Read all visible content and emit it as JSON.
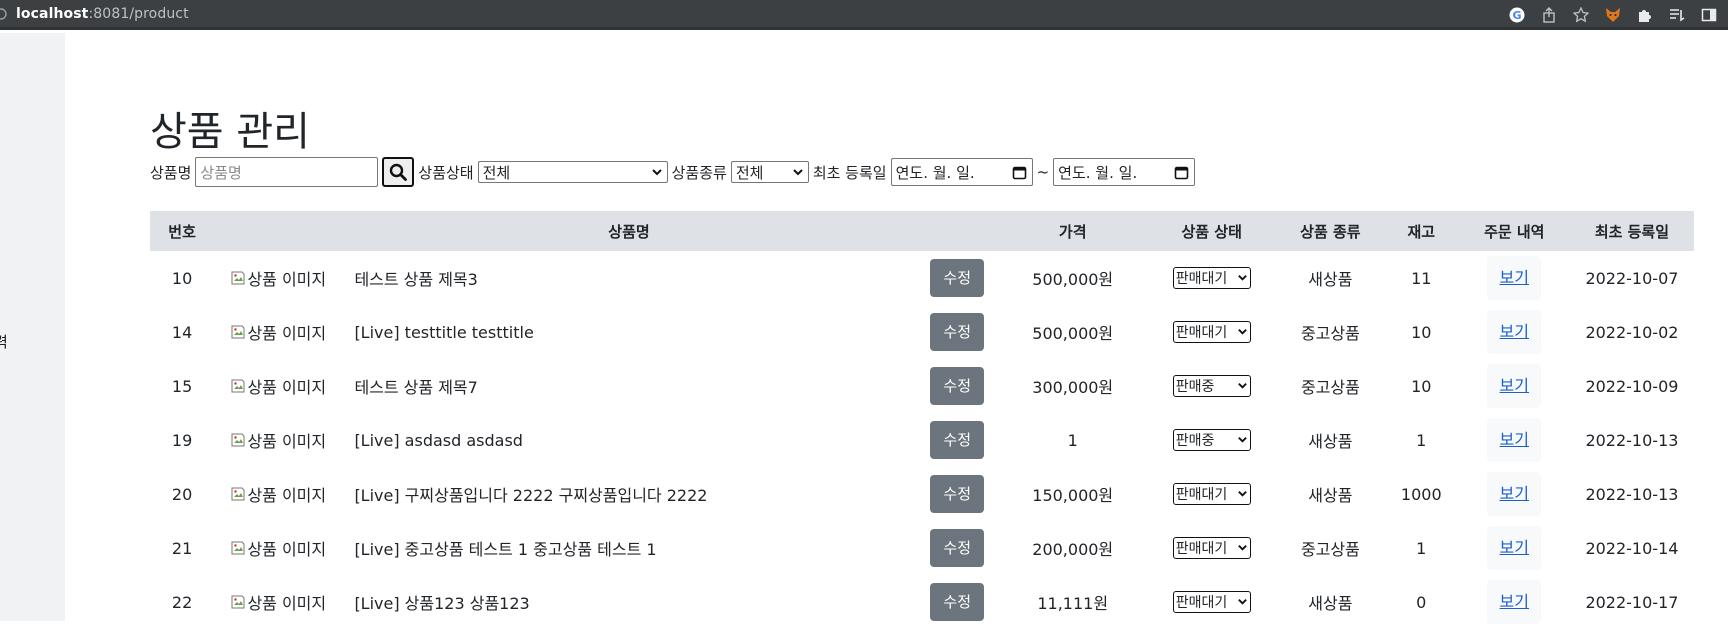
{
  "browser": {
    "url_host": "localhost",
    "url_rest": ":8081/product",
    "icons": [
      "google-icon",
      "share-icon",
      "star-icon",
      "fox-extension-icon",
      "puzzle-extension-icon",
      "reading-list-icon",
      "sidebar-icon"
    ]
  },
  "sidebar": {
    "fragment": "력"
  },
  "page": {
    "title": "상품 관리"
  },
  "filters": {
    "name_label": "상품명",
    "name_placeholder": "상품명",
    "status_label": "상품상태",
    "status_value": "전체",
    "type_label": "상품종류",
    "type_value": "전체",
    "date_label": "최초 등록일",
    "date_from_placeholder": "연도. 월. 일.",
    "date_to_placeholder": "연도. 월. 일.",
    "tilde": "~"
  },
  "table": {
    "headers": {
      "no": "번호",
      "name": "상품명",
      "price": "가격",
      "status": "상품 상태",
      "type": "상품 종류",
      "stock": "재고",
      "orders": "주문 내역",
      "created": "최초 등록일"
    },
    "image_alt": "상품 이미지",
    "edit_label": "수정",
    "view_label": "보기",
    "rows": [
      {
        "no": "10",
        "name": "테스트 상품 제목3",
        "price": "500,000원",
        "status": "판매대기",
        "type": "새상품",
        "stock": "11",
        "created": "2022-10-07"
      },
      {
        "no": "14",
        "name": "[Live] testtitle testtitle",
        "price": "500,000원",
        "status": "판매대기",
        "type": "중고상품",
        "stock": "10",
        "created": "2022-10-02"
      },
      {
        "no": "15",
        "name": "테스트 상품 제목7",
        "price": "300,000원",
        "status": "판매중",
        "type": "중고상품",
        "stock": "10",
        "created": "2022-10-09"
      },
      {
        "no": "19",
        "name": "[Live] asdasd asdasd",
        "price": "1",
        "status": "판매중",
        "type": "새상품",
        "stock": "1",
        "created": "2022-10-13"
      },
      {
        "no": "20",
        "name": "[Live] 구찌상품입니다 2222 구찌상품입니다 2222",
        "price": "150,000원",
        "status": "판매대기",
        "type": "새상품",
        "stock": "1000",
        "created": "2022-10-13"
      },
      {
        "no": "21",
        "name": "[Live] 중고상품 테스트 1 중고상품 테스트 1",
        "price": "200,000원",
        "status": "판매대기",
        "type": "중고상품",
        "stock": "1",
        "created": "2022-10-14"
      },
      {
        "no": "22",
        "name": "[Live] 상품123 상품123",
        "price": "11,111원",
        "status": "판매대기",
        "type": "새상품",
        "stock": "0",
        "created": "2022-10-17"
      }
    ]
  }
}
